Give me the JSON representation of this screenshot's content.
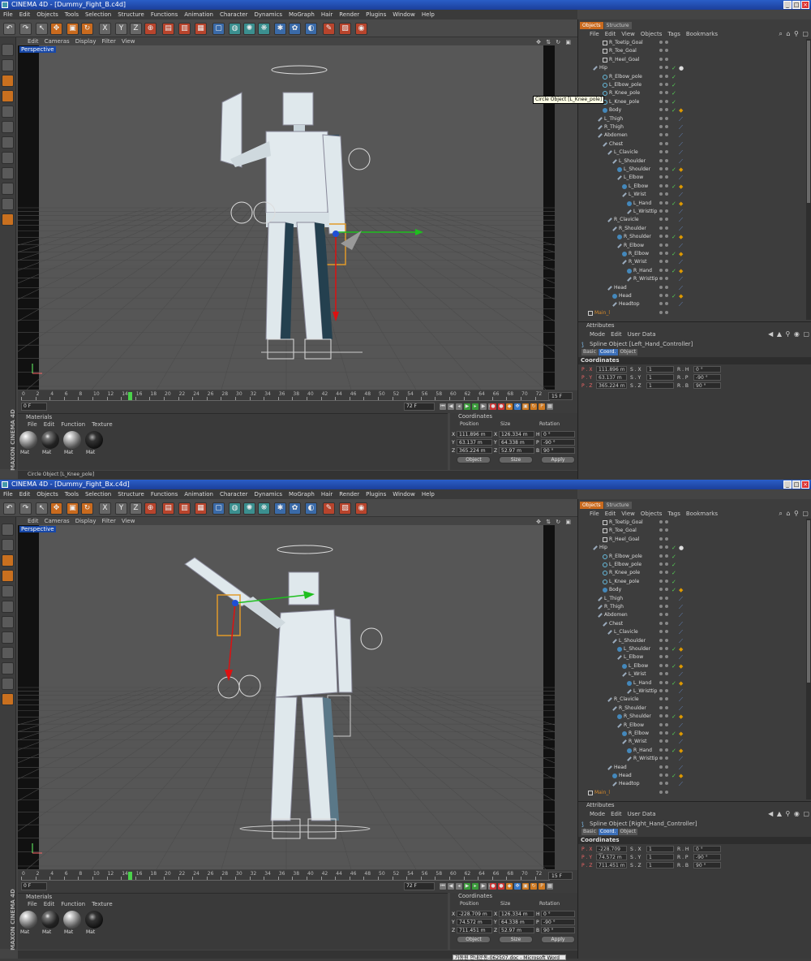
{
  "windows": [
    {
      "title": "CINEMA 4D - [Dummy_Fight_B.c4d]",
      "menu": [
        "File",
        "Edit",
        "Objects",
        "Tools",
        "Selection",
        "Structure",
        "Functions",
        "Animation",
        "Character",
        "Dynamics",
        "MoGraph",
        "Hair",
        "Render",
        "Plugins",
        "Window",
        "Help"
      ],
      "viewport_menu": [
        "Edit",
        "Cameras",
        "Display",
        "Filter",
        "View"
      ],
      "viewport_label": "Perspective",
      "timeline_ticks": [
        "0",
        "2",
        "4",
        "6",
        "8",
        "10",
        "12",
        "14",
        "16",
        "18",
        "20",
        "22",
        "24",
        "26",
        "28",
        "30",
        "32",
        "34",
        "36",
        "38",
        "40",
        "42",
        "44",
        "46",
        "48",
        "50",
        "52",
        "54",
        "56",
        "58",
        "60",
        "62",
        "64",
        "66",
        "68",
        "70",
        "72"
      ],
      "current_frame_marker": "15",
      "frame_right": "15 F",
      "start_field": "0 F",
      "end_field": "72 F",
      "materials_title": "Materials",
      "materials_menu": [
        "File",
        "Edit",
        "Function",
        "Texture"
      ],
      "materials": [
        "Mat",
        "Mat",
        "Mat",
        "Mat"
      ],
      "coord_title": "Coordinates",
      "coord_headers": [
        "Position",
        "Size",
        "Rotation"
      ],
      "coord": {
        "x_label": "X",
        "y_label": "Y",
        "z_label": "Z",
        "px": "111.896 m",
        "py": "63.137 m",
        "pz": "365.224 m",
        "sx": "126.334 m",
        "sy": "64.338 m",
        "sz": "52.97 m",
        "h_label": "H",
        "p_label": "P",
        "b_label": "B",
        "rh": "0 °",
        "rp": "-90 °",
        "rb": "90 °",
        "mode1": "Object",
        "mode2": "Size",
        "apply": "Apply"
      },
      "status": "Circle Object [L_Knee_pole]",
      "objects_tabs": [
        "Objects",
        "Structure"
      ],
      "objects_menu": [
        "File",
        "Edit",
        "View",
        "Objects",
        "Tags",
        "Bookmarks"
      ],
      "tree": [
        {
          "name": "R_Toetip_Goal",
          "indent": 20,
          "kind": "null"
        },
        {
          "name": "R_Toe_Goal",
          "indent": 20,
          "kind": "null"
        },
        {
          "name": "R_Heel_Goal",
          "indent": 20,
          "kind": "null"
        },
        {
          "name": "Hip",
          "indent": 8,
          "kind": "bone"
        },
        {
          "name": "R_Elbow_pole",
          "indent": 20,
          "kind": "circle"
        },
        {
          "name": "L_Elbow_pole",
          "indent": 20,
          "kind": "circle"
        },
        {
          "name": "R_Knee_pole",
          "indent": 20,
          "kind": "circle"
        },
        {
          "name": "L_Knee_pole",
          "indent": 20,
          "kind": "circle"
        },
        {
          "name": "Body",
          "indent": 20,
          "kind": "obj"
        },
        {
          "name": "L_Thigh",
          "indent": 14,
          "kind": "bone"
        },
        {
          "name": "R_Thigh",
          "indent": 14,
          "kind": "bone"
        },
        {
          "name": "Abdomen",
          "indent": 14,
          "kind": "bone"
        },
        {
          "name": "Chest",
          "indent": 20,
          "kind": "bone"
        },
        {
          "name": "L_Clavicle",
          "indent": 26,
          "kind": "bone"
        },
        {
          "name": "L_Shoulder",
          "indent": 32,
          "kind": "bone"
        },
        {
          "name": "L_Shoulder",
          "indent": 38,
          "kind": "obj"
        },
        {
          "name": "L_Elbow",
          "indent": 38,
          "kind": "bone"
        },
        {
          "name": "L_Elbow",
          "indent": 44,
          "kind": "obj"
        },
        {
          "name": "L_Wrist",
          "indent": 44,
          "kind": "bone"
        },
        {
          "name": "L_Hand",
          "indent": 50,
          "kind": "obj"
        },
        {
          "name": "L_Wristtip",
          "indent": 50,
          "kind": "bone"
        },
        {
          "name": "R_Clavicle",
          "indent": 26,
          "kind": "bone"
        },
        {
          "name": "R_Shoulder",
          "indent": 32,
          "kind": "bone"
        },
        {
          "name": "R_Shoulder",
          "indent": 38,
          "kind": "obj"
        },
        {
          "name": "R_Elbow",
          "indent": 38,
          "kind": "bone"
        },
        {
          "name": "R_Elbow",
          "indent": 44,
          "kind": "obj"
        },
        {
          "name": "R_Wrist",
          "indent": 44,
          "kind": "bone"
        },
        {
          "name": "R_Hand",
          "indent": 50,
          "kind": "obj"
        },
        {
          "name": "R_Wristtip",
          "indent": 50,
          "kind": "bone"
        },
        {
          "name": "Head",
          "indent": 26,
          "kind": "bone"
        },
        {
          "name": "Head",
          "indent": 32,
          "kind": "obj"
        },
        {
          "name": "Headtop",
          "indent": 32,
          "kind": "bone"
        },
        {
          "name": "Main_l",
          "indent": 2,
          "kind": "null"
        }
      ],
      "tooltip": "Circle Object [L_Knee_pole]",
      "attributes_title": "Attributes",
      "attributes_menu": [
        "Mode",
        "Edit",
        "User Data"
      ],
      "attr_name": "Spline Object [Left_Hand_Controller]",
      "attr_tabs": [
        "Basic",
        "Coord.",
        "Object"
      ],
      "attr_section": "Coordinates",
      "attr": {
        "p_label": "P . X",
        "py_label": "P . Y",
        "pz_label": "P . Z",
        "px": "111.896 m",
        "py": "63.137 m",
        "pz": "365.224 m",
        "s_label": "S . X",
        "sy_label": "S . Y",
        "sz_label": "S . Z",
        "sx": "1",
        "sy": "1",
        "sz": "1",
        "r_label": "R . H",
        "ry_label": "R . P",
        "rz_label": "R . B",
        "rh": "0 °",
        "rp": "-90 °",
        "rb": "90 °"
      }
    },
    {
      "title": "CINEMA 4D - [Dummy_Fight_Bx.c4d]",
      "menu": [
        "File",
        "Edit",
        "Objects",
        "Tools",
        "Selection",
        "Structure",
        "Functions",
        "Animation",
        "Character",
        "Dynamics",
        "MoGraph",
        "Hair",
        "Render",
        "Plugins",
        "Window",
        "Help"
      ],
      "viewport_menu": [
        "Edit",
        "Cameras",
        "Display",
        "Filter",
        "View"
      ],
      "viewport_label": "Perspective",
      "timeline_ticks": [
        "0",
        "2",
        "4",
        "6",
        "8",
        "10",
        "12",
        "14",
        "16",
        "18",
        "20",
        "22",
        "24",
        "26",
        "28",
        "30",
        "32",
        "34",
        "36",
        "38",
        "40",
        "42",
        "44",
        "46",
        "48",
        "50",
        "52",
        "54",
        "56",
        "58",
        "60",
        "62",
        "64",
        "66",
        "68",
        "70",
        "72"
      ],
      "current_frame_marker": "15",
      "frame_right": "15 F",
      "start_field": "0 F",
      "end_field": "72 F",
      "materials_title": "Materials",
      "materials_menu": [
        "File",
        "Edit",
        "Function",
        "Texture"
      ],
      "materials": [
        "Mat",
        "Mat",
        "Mat",
        "Mat"
      ],
      "coord_title": "Coordinates",
      "coord_headers": [
        "Position",
        "Size",
        "Rotation"
      ],
      "coord": {
        "x_label": "X",
        "y_label": "Y",
        "z_label": "Z",
        "px": "-228.709 m",
        "py": "74.572 m",
        "pz": "711.451 m",
        "sx": "126.334 m",
        "sy": "64.338 m",
        "sz": "52.97 m",
        "h_label": "H",
        "p_label": "P",
        "b_label": "B",
        "rh": "0 °",
        "rp": "-90 °",
        "rb": "90 °",
        "mode1": "Object",
        "mode2": "Size",
        "apply": "Apply"
      },
      "status": "",
      "objects_tabs": [
        "Objects",
        "Structure"
      ],
      "objects_menu": [
        "File",
        "Edit",
        "View",
        "Objects",
        "Tags",
        "Bookmarks"
      ],
      "tree": [
        {
          "name": "R_Toetip_Goal",
          "indent": 20,
          "kind": "null"
        },
        {
          "name": "R_Toe_Goal",
          "indent": 20,
          "kind": "null"
        },
        {
          "name": "R_Heel_Goal",
          "indent": 20,
          "kind": "null"
        },
        {
          "name": "Hip",
          "indent": 8,
          "kind": "bone"
        },
        {
          "name": "R_Elbow_pole",
          "indent": 20,
          "kind": "circle"
        },
        {
          "name": "L_Elbow_pole",
          "indent": 20,
          "kind": "circle"
        },
        {
          "name": "R_Knee_pole",
          "indent": 20,
          "kind": "circle"
        },
        {
          "name": "L_Knee_pole",
          "indent": 20,
          "kind": "circle"
        },
        {
          "name": "Body",
          "indent": 20,
          "kind": "obj"
        },
        {
          "name": "L_Thigh",
          "indent": 14,
          "kind": "bone"
        },
        {
          "name": "R_Thigh",
          "indent": 14,
          "kind": "bone"
        },
        {
          "name": "Abdomen",
          "indent": 14,
          "kind": "bone"
        },
        {
          "name": "Chest",
          "indent": 20,
          "kind": "bone"
        },
        {
          "name": "L_Clavicle",
          "indent": 26,
          "kind": "bone"
        },
        {
          "name": "L_Shoulder",
          "indent": 32,
          "kind": "bone"
        },
        {
          "name": "L_Shoulder",
          "indent": 38,
          "kind": "obj"
        },
        {
          "name": "L_Elbow",
          "indent": 38,
          "kind": "bone"
        },
        {
          "name": "L_Elbow",
          "indent": 44,
          "kind": "obj"
        },
        {
          "name": "L_Wrist",
          "indent": 44,
          "kind": "bone"
        },
        {
          "name": "L_Hand",
          "indent": 50,
          "kind": "obj"
        },
        {
          "name": "L_Wristtip",
          "indent": 50,
          "kind": "bone"
        },
        {
          "name": "R_Clavicle",
          "indent": 26,
          "kind": "bone"
        },
        {
          "name": "R_Shoulder",
          "indent": 32,
          "kind": "bone"
        },
        {
          "name": "R_Shoulder",
          "indent": 38,
          "kind": "obj"
        },
        {
          "name": "R_Elbow",
          "indent": 38,
          "kind": "bone"
        },
        {
          "name": "R_Elbow",
          "indent": 44,
          "kind": "obj"
        },
        {
          "name": "R_Wrist",
          "indent": 44,
          "kind": "bone"
        },
        {
          "name": "R_Hand",
          "indent": 50,
          "kind": "obj"
        },
        {
          "name": "R_Wristtip",
          "indent": 50,
          "kind": "bone"
        },
        {
          "name": "Head",
          "indent": 26,
          "kind": "bone"
        },
        {
          "name": "Head",
          "indent": 32,
          "kind": "obj"
        },
        {
          "name": "Headtop",
          "indent": 32,
          "kind": "bone"
        },
        {
          "name": "Main_l",
          "indent": 2,
          "kind": "null"
        }
      ],
      "tooltip": "",
      "attributes_title": "Attributes",
      "attributes_menu": [
        "Mode",
        "Edit",
        "User Data"
      ],
      "attr_name": "Spline Object [Right_Hand_Controller]",
      "attr_tabs": [
        "Basic",
        "Coord.",
        "Object"
      ],
      "attr_section": "Coordinates",
      "attr": {
        "p_label": "P . X",
        "py_label": "P . Y",
        "pz_label": "P . Z",
        "px": "-228.709 m",
        "py": "74.572 m",
        "pz": "711.451 m",
        "s_label": "S . X",
        "sy_label": "S . Y",
        "sz_label": "S . Z",
        "sx": "1",
        "sy": "1",
        "sz": "1",
        "r_label": "R . H",
        "ry_label": "R . P",
        "rz_label": "R . B",
        "rh": "0 °",
        "rp": "-90 °",
        "rb": "90 °"
      }
    }
  ],
  "taskbar_item": "가동원 안내운동-062507.doc - Microsoft Word",
  "colors": {
    "accent": "#c96a1e",
    "title_blue": "#2a5ec8",
    "x_axis": "#1fbf1f",
    "y_axis": "#d11",
    "z_axis": "#1f4fd6"
  }
}
